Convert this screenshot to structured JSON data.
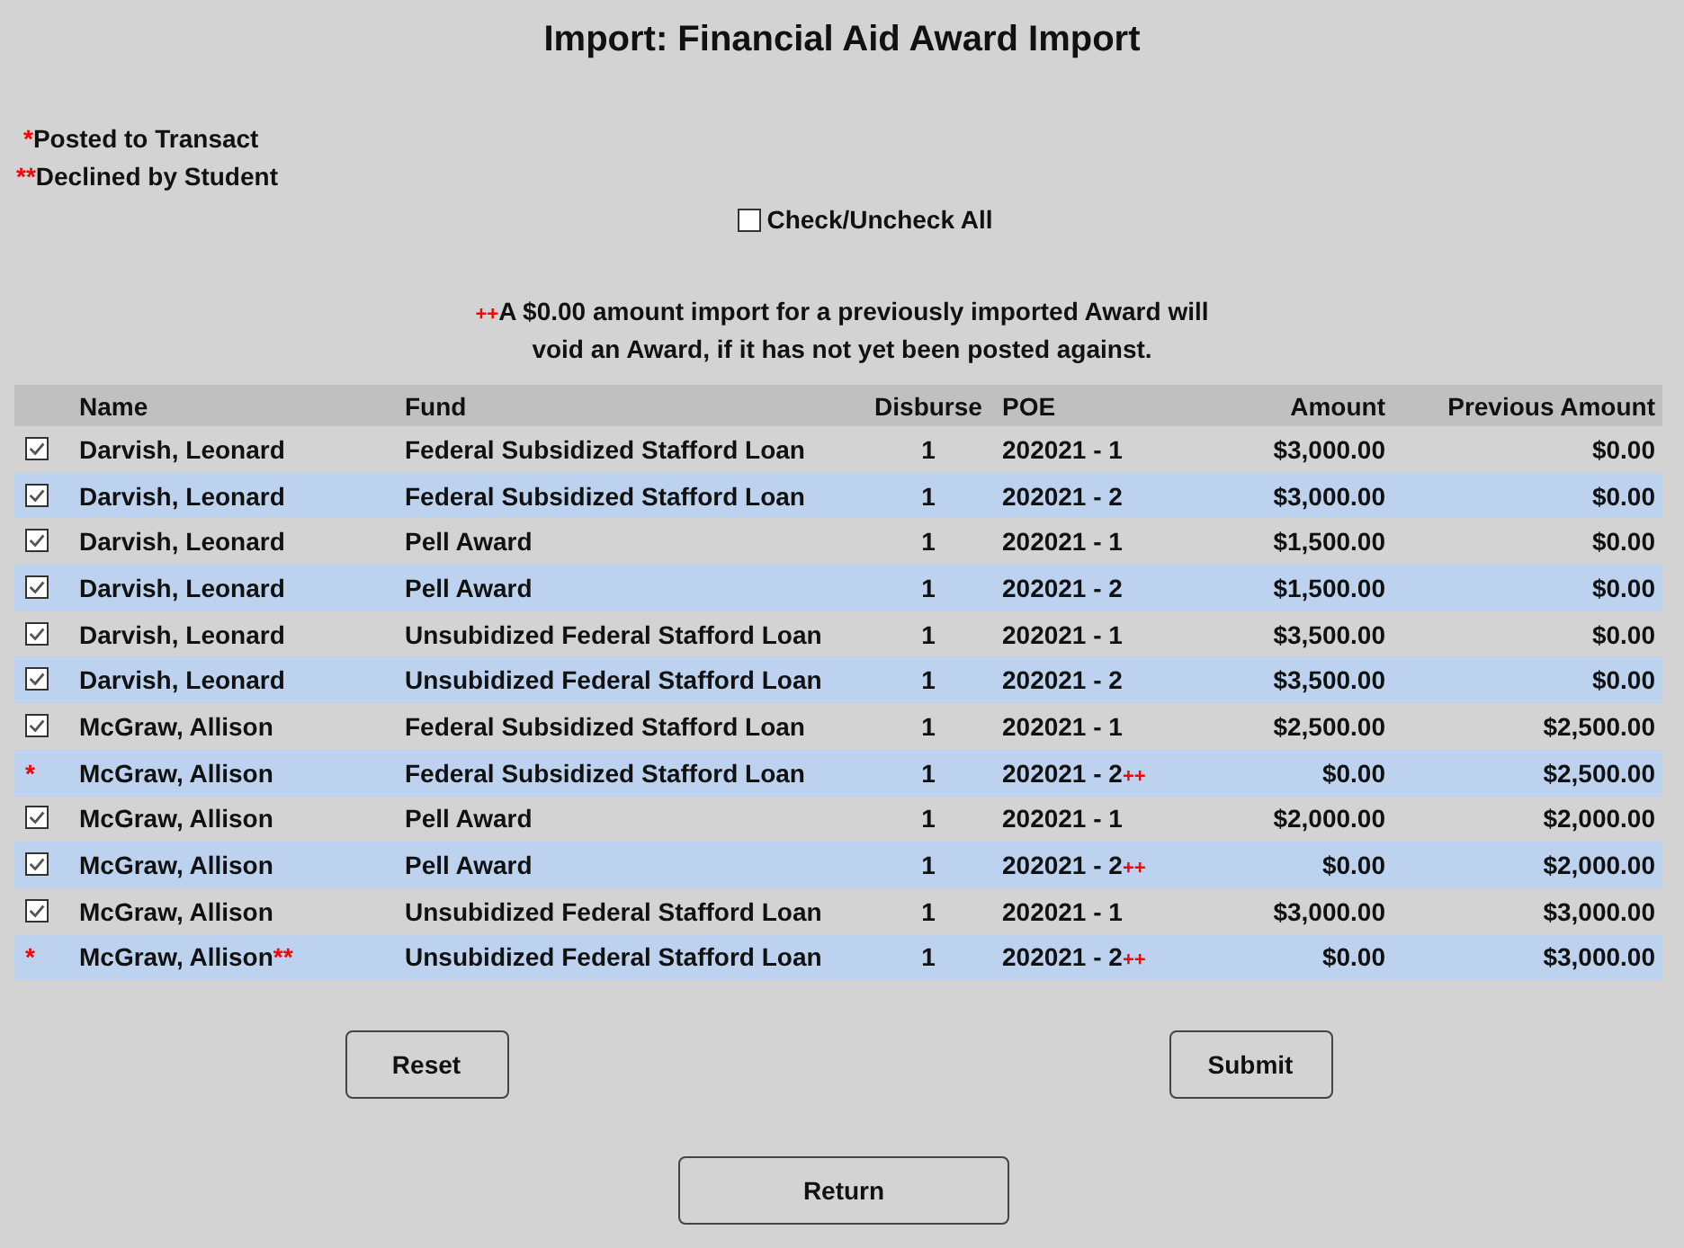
{
  "title": "Import: Financial Aid Award Import",
  "legend": [
    {
      "mark": "*",
      "text": "Posted to Transact"
    },
    {
      "mark": "**",
      "text": "Declined by Student"
    }
  ],
  "check_all": {
    "label": "Check/Uncheck All",
    "checked": false
  },
  "note": {
    "mark": "++",
    "lines": [
      "A $0.00 amount import for a previously imported Award will",
      "void an Award, if it has not yet been posted against."
    ]
  },
  "table": {
    "columns": [
      "Name",
      "Fund",
      "Disburse",
      "POE",
      "Amount",
      "Previous Amount"
    ],
    "rows": [
      {
        "kind": "checkbox",
        "checked": true,
        "name": "Darvish, Leonard",
        "fund": "Federal Subsidized Stafford Loan",
        "disburse": "1",
        "poe": "202021 - 1",
        "amount": "$3,000.00",
        "previous_amount": "$0.00"
      },
      {
        "kind": "checkbox",
        "checked": true,
        "name": "Darvish, Leonard",
        "fund": "Federal Subsidized Stafford Loan",
        "disburse": "1",
        "poe": "202021 - 2",
        "amount": "$3,000.00",
        "previous_amount": "$0.00"
      },
      {
        "kind": "checkbox",
        "checked": true,
        "name": "Darvish, Leonard",
        "fund": "Pell Award",
        "disburse": "1",
        "poe": "202021 - 1",
        "amount": "$1,500.00",
        "previous_amount": "$0.00"
      },
      {
        "kind": "checkbox",
        "checked": true,
        "name": "Darvish, Leonard",
        "fund": "Pell Award",
        "disburse": "1",
        "poe": "202021 - 2",
        "amount": "$1,500.00",
        "previous_amount": "$0.00"
      },
      {
        "kind": "checkbox",
        "checked": true,
        "name": "Darvish, Leonard",
        "fund": "Unsubidized Federal Stafford Loan",
        "disburse": "1",
        "poe": "202021 - 1",
        "amount": "$3,500.00",
        "previous_amount": "$0.00"
      },
      {
        "kind": "checkbox",
        "checked": true,
        "name": "Darvish, Leonard",
        "fund": "Unsubidized Federal Stafford Loan",
        "disburse": "1",
        "poe": "202021 - 2",
        "amount": "$3,500.00",
        "previous_amount": "$0.00"
      },
      {
        "kind": "checkbox",
        "checked": true,
        "name": "McGraw, Allison",
        "fund": "Federal Subsidized Stafford Loan",
        "disburse": "1",
        "poe": "202021 - 1",
        "amount": "$2,500.00",
        "previous_amount": "$2,500.00"
      },
      {
        "kind": "posted",
        "mark": "*",
        "name": "McGraw, Allison",
        "fund": "Federal Subsidized Stafford Loan",
        "disburse": "1",
        "poe": "202021 - 2",
        "poe_mark": "++",
        "amount": "$0.00",
        "previous_amount": "$2,500.00"
      },
      {
        "kind": "checkbox",
        "checked": true,
        "name": "McGraw, Allison",
        "fund": "Pell Award",
        "disburse": "1",
        "poe": "202021 - 1",
        "amount": "$2,000.00",
        "previous_amount": "$2,000.00"
      },
      {
        "kind": "checkbox",
        "checked": true,
        "name": "McGraw, Allison",
        "fund": "Pell Award",
        "disburse": "1",
        "poe": "202021 - 2",
        "poe_mark": "++",
        "amount": "$0.00",
        "previous_amount": "$2,000.00"
      },
      {
        "kind": "checkbox",
        "checked": true,
        "name": "McGraw, Allison",
        "fund": "Unsubidized Federal Stafford Loan",
        "disburse": "1",
        "poe": "202021 - 1",
        "amount": "$3,000.00",
        "previous_amount": "$3,000.00"
      },
      {
        "kind": "posted",
        "mark": "*",
        "name": "McGraw, Allison",
        "name_mark": "**",
        "fund": "Unsubidized Federal Stafford Loan",
        "disburse": "1",
        "poe": "202021 - 2",
        "poe_mark": "++",
        "amount": "$0.00",
        "previous_amount": "$3,000.00"
      }
    ]
  },
  "buttons": [
    "Reset",
    "Submit",
    "Return"
  ]
}
